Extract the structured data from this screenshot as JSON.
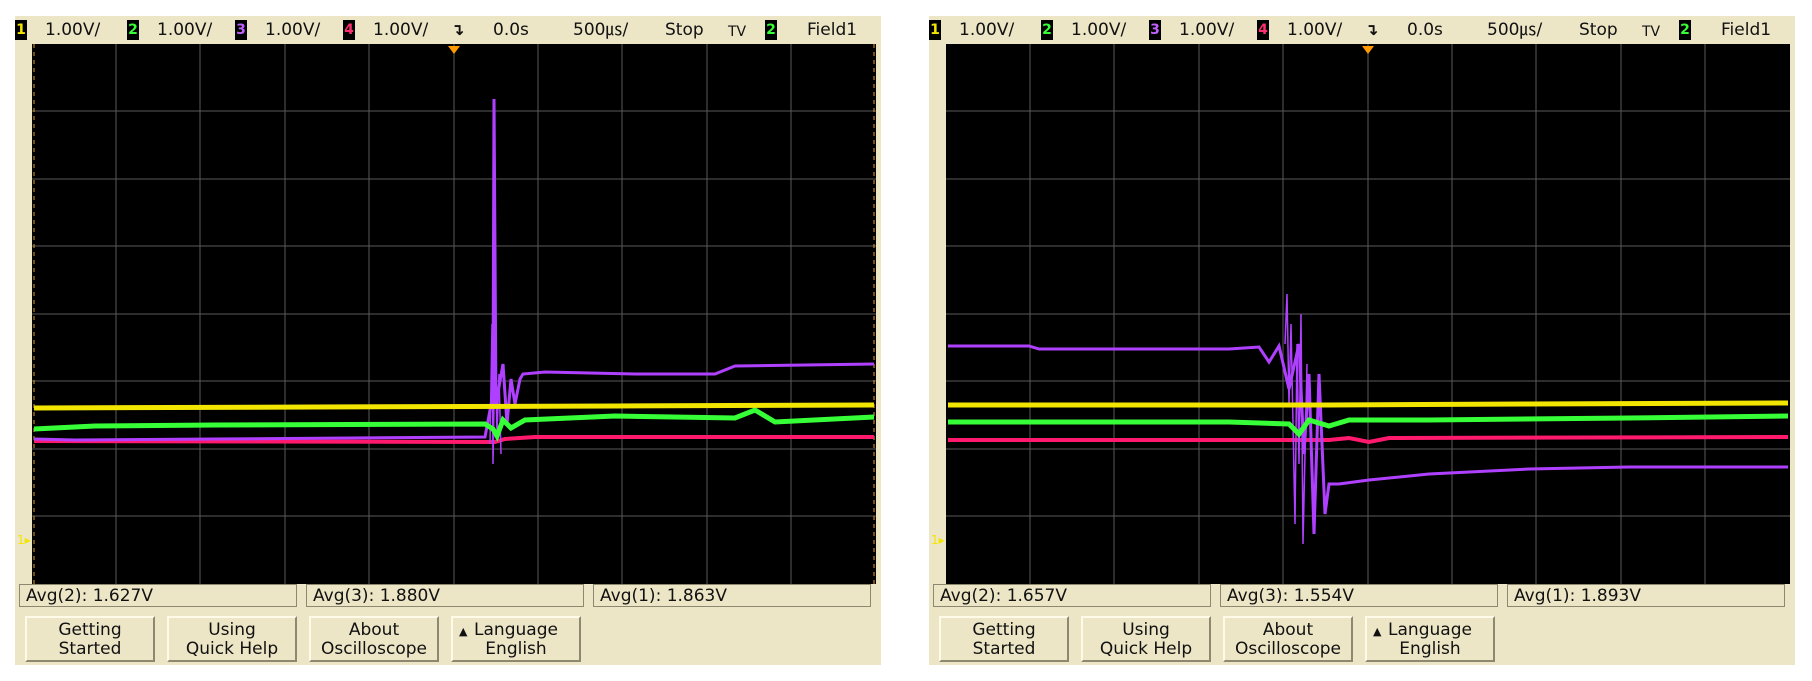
{
  "scopes": [
    {
      "status": {
        "ch1": {
          "num": "1",
          "scale": "1.00V/"
        },
        "ch2": {
          "num": "2",
          "scale": "1.00V/"
        },
        "ch3": {
          "num": "3",
          "scale": "1.00V/"
        },
        "ch4": {
          "num": "4",
          "scale": "1.00V/"
        },
        "delay": "0.0s",
        "timebase": "500㎲/",
        "run_state": "Stop",
        "trigger_mode": "TV",
        "trigger_source": "2",
        "trigger_field": "Field1"
      },
      "measurements": [
        {
          "label": "Avg(2): 1.627V"
        },
        {
          "label": "Avg(3): 1.880V"
        },
        {
          "label": "Avg(1): 1.863V"
        }
      ],
      "softkeys": [
        {
          "line1": "Getting",
          "line2": "Started"
        },
        {
          "line1": "Using",
          "line2": "Quick Help"
        },
        {
          "line1": "About",
          "line2": "Oscilloscope"
        },
        {
          "line1": "Language",
          "line2": "English",
          "arrow": "▲"
        }
      ]
    },
    {
      "status": {
        "ch1": {
          "num": "1",
          "scale": "1.00V/"
        },
        "ch2": {
          "num": "2",
          "scale": "1.00V/"
        },
        "ch3": {
          "num": "3",
          "scale": "1.00V/"
        },
        "ch4": {
          "num": "4",
          "scale": "1.00V/"
        },
        "delay": "0.0s",
        "timebase": "500㎲/",
        "run_state": "Stop",
        "trigger_mode": "TV",
        "trigger_source": "2",
        "trigger_field": "Field1"
      },
      "measurements": [
        {
          "label": "Avg(2): 1.657V"
        },
        {
          "label": "Avg(3): 1.554V"
        },
        {
          "label": "Avg(1): 1.893V"
        }
      ],
      "softkeys": [
        {
          "line1": "Getting",
          "line2": "Started"
        },
        {
          "line1": "Using",
          "line2": "Quick Help"
        },
        {
          "line1": "About",
          "line2": "Oscilloscope"
        },
        {
          "line1": "Language",
          "line2": "English",
          "arrow": "▲"
        }
      ]
    }
  ],
  "colors": {
    "ch1": "#f2e500",
    "ch2": "#37ff37",
    "ch3": "#b040ff",
    "ch4": "#ff1a6e",
    "grid": "#5a5a5a",
    "screen_bg": "#000000",
    "bezel": "#ece6c6"
  },
  "icons": {
    "trigger": "trigger-edge-icon",
    "ground": "ground-marker-icon",
    "arrow": "triangle-up-icon"
  }
}
